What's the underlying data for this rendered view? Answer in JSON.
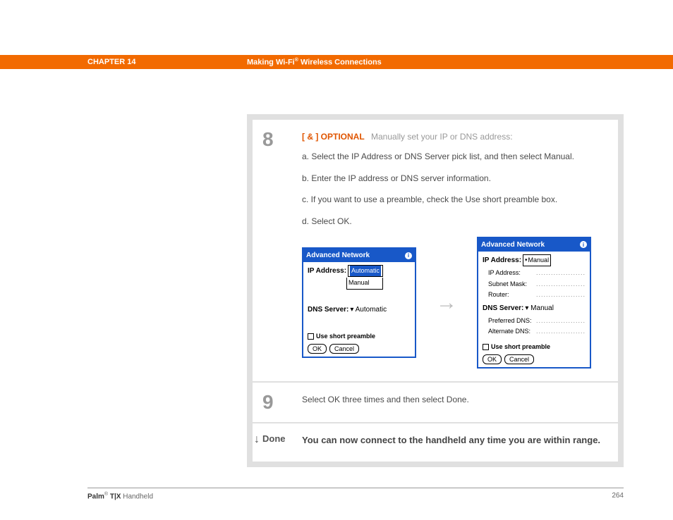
{
  "header": {
    "chapter": "CHAPTER 14",
    "title_pre": "Making Wi-Fi",
    "reg": "®",
    "title_post": " Wireless Connections"
  },
  "step8": {
    "num": "8",
    "tag": "[ & ]  OPTIONAL",
    "intro": "Manually set your IP or DNS address:",
    "a": "a.  Select the IP Address or DNS Server pick list, and then select Manual.",
    "b": "b.  Enter the IP address or DNS server information.",
    "c": "c.  If you want to use a preamble, check the Use short preamble box.",
    "d": "d.  Select OK."
  },
  "shot_left": {
    "title": "Advanced Network",
    "ip_label": "IP Address:",
    "ip_sel": "Automatic",
    "ip_opt2": "Manual",
    "dns_label": "DNS Server:",
    "dns_val": "Automatic",
    "preamble": "Use short preamble",
    "ok": "OK",
    "cancel": "Cancel"
  },
  "shot_right": {
    "title": "Advanced Network",
    "ip_label": "IP Address:",
    "ip_sel": "Manual",
    "ip_addr_l": "IP Address:",
    "subnet_l": "Subnet Mask:",
    "router_l": "Router:",
    "dns_label": "DNS Server:",
    "dns_val": "Manual",
    "pref_l": "Preferred DNS:",
    "alt_l": "Alternate DNS:",
    "preamble": "Use short preamble",
    "ok": "OK",
    "cancel": "Cancel",
    "dots": "...................."
  },
  "step9": {
    "num": "9",
    "text": "Select OK three times and then select Done."
  },
  "done": {
    "label": "Done",
    "text": "You can now connect to the handheld any time you are within range."
  },
  "footer": {
    "brand_pre": "Palm",
    "reg": "®",
    "brand_mid": " T|X",
    "brand_post": " Handheld",
    "page": "264"
  }
}
